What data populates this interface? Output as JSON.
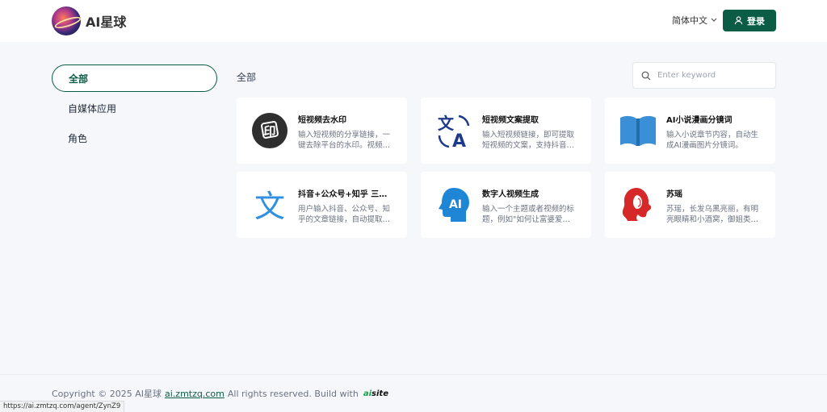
{
  "header": {
    "brand": "AI星球",
    "language": "简体中文",
    "login_label": "登录"
  },
  "sidebar": {
    "items": [
      {
        "label": "全部",
        "active": true
      },
      {
        "label": "自媒体应用",
        "active": false
      },
      {
        "label": "角色",
        "active": false
      }
    ]
  },
  "main": {
    "section_title": "全部",
    "search": {
      "placeholder": "Enter keyword",
      "value": ""
    },
    "cards": [
      {
        "title": "短视频去水印",
        "desc": "输入短视频的分享链接，一键去除平台的水印。视频…",
        "icon": "watermark-remove-icon"
      },
      {
        "title": "短视频文案提取",
        "desc": "输入短视频链接，即可提取短视频的文案，支持抖音…",
        "icon": "translate-icon"
      },
      {
        "title": "AI小说漫画分镜词",
        "desc": "输入小说章节内容，自动生成AI漫画图片分镜词。",
        "icon": "book-icon"
      },
      {
        "title": "抖音+公众号+知乎 三平…",
        "desc": "用户输入抖音、公众号、知乎的文章链接，自动提取…",
        "icon": "text-icon"
      },
      {
        "title": "数字人视频生成",
        "desc": "输入一个主题或者视频的标题，例如\"如何让富婆爱…",
        "icon": "ai-head-icon"
      },
      {
        "title": "苏瑶",
        "desc": "苏瑶，长发乌黑亮丽，有明亮眼睛和小酒窝，御姐类…",
        "icon": "woman-avatar-icon"
      }
    ]
  },
  "footer": {
    "copyright": "Copyright © 2025 AI星球",
    "link": "ai.zmtzq.com",
    "rights": "All rights reserved. Build with",
    "brand_prefix": "ai",
    "brand_suffix": "site"
  },
  "status_url": "https://ai.zmtzq.com/agent/ZynZ9",
  "colors": {
    "accent": "#0a5c45",
    "background": "#f5f7fa"
  }
}
